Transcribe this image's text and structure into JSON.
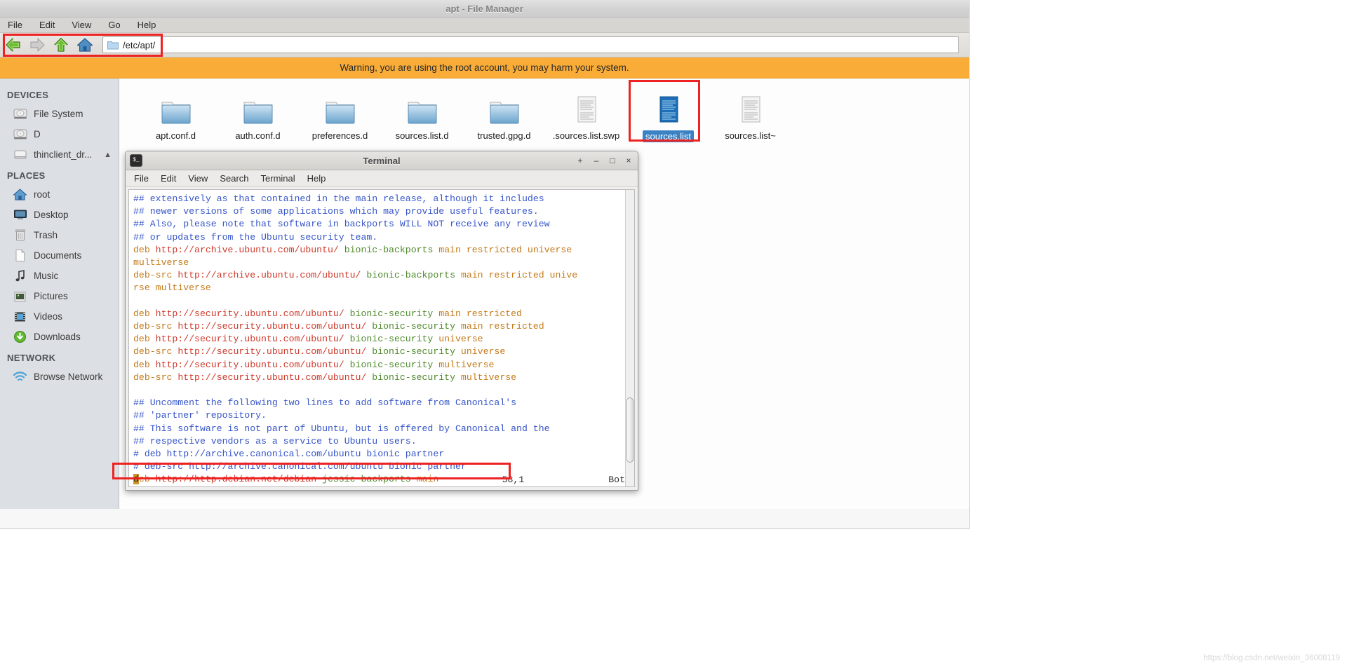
{
  "file_manager": {
    "title": "apt - File Manager",
    "menu": [
      "File",
      "Edit",
      "View",
      "Go",
      "Help"
    ],
    "toolbar": {
      "back_icon": "arrow-left-icon",
      "forward_icon": "arrow-right-icon",
      "up_icon": "arrow-up-icon",
      "home_icon": "home-icon",
      "path_icon": "folder-icon",
      "path_value": "/etc/apt/"
    },
    "warning": "Warning, you are using the root account, you may harm your system.",
    "sidebar": {
      "groups": [
        {
          "title": "DEVICES",
          "items": [
            {
              "label": "File System",
              "icon": "harddisk-icon",
              "eject": false
            },
            {
              "label": "D",
              "icon": "harddisk-icon",
              "eject": false
            },
            {
              "label": "thinclient_dr...",
              "icon": "drive-icon",
              "eject": true
            }
          ]
        },
        {
          "title": "PLACES",
          "items": [
            {
              "label": "root",
              "icon": "home-icon",
              "eject": false
            },
            {
              "label": "Desktop",
              "icon": "desktop-icon",
              "eject": false
            },
            {
              "label": "Trash",
              "icon": "trash-icon",
              "eject": false
            },
            {
              "label": "Documents",
              "icon": "document-icon",
              "eject": false
            },
            {
              "label": "Music",
              "icon": "music-note-icon",
              "eject": false
            },
            {
              "label": "Pictures",
              "icon": "picture-icon",
              "eject": false
            },
            {
              "label": "Videos",
              "icon": "film-icon",
              "eject": false
            },
            {
              "label": "Downloads",
              "icon": "download-arrow-icon",
              "eject": false
            }
          ]
        },
        {
          "title": "NETWORK",
          "items": [
            {
              "label": "Browse Network",
              "icon": "network-wifi-icon",
              "eject": false
            }
          ]
        }
      ]
    },
    "files": [
      {
        "name": "apt.conf.d",
        "type": "folder",
        "selected": false
      },
      {
        "name": "auth.conf.d",
        "type": "folder",
        "selected": false
      },
      {
        "name": "preferences.d",
        "type": "folder",
        "selected": false
      },
      {
        "name": "sources.list.d",
        "type": "folder",
        "selected": false
      },
      {
        "name": "trusted.gpg.d",
        "type": "folder",
        "selected": false
      },
      {
        "name": ".sources.list.swp",
        "type": "text",
        "selected": false
      },
      {
        "name": "sources.list",
        "type": "text-selected",
        "selected": true
      },
      {
        "name": "sources.list~",
        "type": "text",
        "selected": false
      }
    ]
  },
  "terminal": {
    "title": "Terminal",
    "app_icon": "terminal-icon",
    "window_buttons": {
      "shade": "+",
      "minimize": "–",
      "maximize": "□",
      "close": "×"
    },
    "menu": [
      "File",
      "Edit",
      "View",
      "Search",
      "Terminal",
      "Help"
    ],
    "status": {
      "position": "58,1",
      "scroll": "Bot"
    },
    "lines": [
      {
        "segs": [
          {
            "t": "## extensively as that contained in the main release, although it includes",
            "c": "c-comment"
          }
        ]
      },
      {
        "segs": [
          {
            "t": "## newer versions of some applications which may provide useful features.",
            "c": "c-comment"
          }
        ]
      },
      {
        "segs": [
          {
            "t": "## Also, please note that software in backports WILL NOT receive any review",
            "c": "c-comment"
          }
        ]
      },
      {
        "segs": [
          {
            "t": "## or updates from the Ubuntu security team.",
            "c": "c-comment"
          }
        ]
      },
      {
        "segs": [
          {
            "t": "deb ",
            "c": "c-type"
          },
          {
            "t": "http://archive.ubuntu.com/ubuntu/ ",
            "c": "c-url"
          },
          {
            "t": "bionic-backports ",
            "c": "c-dist"
          },
          {
            "t": "main restricted universe",
            "c": "c-comp"
          }
        ]
      },
      {
        "segs": [
          {
            "t": "multiverse",
            "c": "c-comp"
          }
        ]
      },
      {
        "segs": [
          {
            "t": "deb-src ",
            "c": "c-type"
          },
          {
            "t": "http://archive.ubuntu.com/ubuntu/ ",
            "c": "c-url"
          },
          {
            "t": "bionic-backports ",
            "c": "c-dist"
          },
          {
            "t": "main restricted unive",
            "c": "c-comp"
          }
        ]
      },
      {
        "segs": [
          {
            "t": "rse multiverse",
            "c": "c-comp"
          }
        ]
      },
      {
        "segs": [
          {
            "t": "",
            "c": "c-plain"
          }
        ]
      },
      {
        "segs": [
          {
            "t": "deb ",
            "c": "c-type"
          },
          {
            "t": "http://security.ubuntu.com/ubuntu/ ",
            "c": "c-url"
          },
          {
            "t": "bionic-security ",
            "c": "c-dist"
          },
          {
            "t": "main restricted",
            "c": "c-comp"
          }
        ]
      },
      {
        "segs": [
          {
            "t": "deb-src ",
            "c": "c-type"
          },
          {
            "t": "http://security.ubuntu.com/ubuntu/ ",
            "c": "c-url"
          },
          {
            "t": "bionic-security ",
            "c": "c-dist"
          },
          {
            "t": "main restricted",
            "c": "c-comp"
          }
        ]
      },
      {
        "segs": [
          {
            "t": "deb ",
            "c": "c-type"
          },
          {
            "t": "http://security.ubuntu.com/ubuntu/ ",
            "c": "c-url"
          },
          {
            "t": "bionic-security ",
            "c": "c-dist"
          },
          {
            "t": "universe",
            "c": "c-comp"
          }
        ]
      },
      {
        "segs": [
          {
            "t": "deb-src ",
            "c": "c-type"
          },
          {
            "t": "http://security.ubuntu.com/ubuntu/ ",
            "c": "c-url"
          },
          {
            "t": "bionic-security ",
            "c": "c-dist"
          },
          {
            "t": "universe",
            "c": "c-comp"
          }
        ]
      },
      {
        "segs": [
          {
            "t": "deb ",
            "c": "c-type"
          },
          {
            "t": "http://security.ubuntu.com/ubuntu/ ",
            "c": "c-url"
          },
          {
            "t": "bionic-security ",
            "c": "c-dist"
          },
          {
            "t": "multiverse",
            "c": "c-comp"
          }
        ]
      },
      {
        "segs": [
          {
            "t": "deb-src ",
            "c": "c-type"
          },
          {
            "t": "http://security.ubuntu.com/ubuntu/ ",
            "c": "c-url"
          },
          {
            "t": "bionic-security ",
            "c": "c-dist"
          },
          {
            "t": "multiverse",
            "c": "c-comp"
          }
        ]
      },
      {
        "segs": [
          {
            "t": "",
            "c": "c-plain"
          }
        ]
      },
      {
        "segs": [
          {
            "t": "## Uncomment the following two lines to add software from Canonical's",
            "c": "c-comment"
          }
        ]
      },
      {
        "segs": [
          {
            "t": "## 'partner' repository.",
            "c": "c-comment"
          }
        ]
      },
      {
        "segs": [
          {
            "t": "## This software is not part of Ubuntu, but is offered by Canonical and the",
            "c": "c-comment"
          }
        ]
      },
      {
        "segs": [
          {
            "t": "## respective vendors as a service to Ubuntu users.",
            "c": "c-comment"
          }
        ]
      },
      {
        "segs": [
          {
            "t": "# deb http://archive.canonical.com/ubuntu bionic partner",
            "c": "c-comment"
          }
        ]
      },
      {
        "segs": [
          {
            "t": "# deb-src http://archive.canonical.com/ubuntu bionic partner",
            "c": "c-comment"
          }
        ]
      },
      {
        "segs": [
          {
            "t": "d",
            "c": "cursor-blk"
          },
          {
            "t": "eb ",
            "c": "c-type"
          },
          {
            "t": "http://http.debian.net/debian ",
            "c": "c-url"
          },
          {
            "t": "jessie-backports ",
            "c": "c-dist"
          },
          {
            "t": "main",
            "c": "c-comp"
          }
        ]
      }
    ]
  },
  "watermark": "https://blog.csdn.net/weixin_36008119",
  "colors": {
    "warning_bg": "#f9ac37",
    "annotation": "#ee2222",
    "selection": "#3b82c4",
    "sidebar_bg": "#dcdfe3"
  }
}
